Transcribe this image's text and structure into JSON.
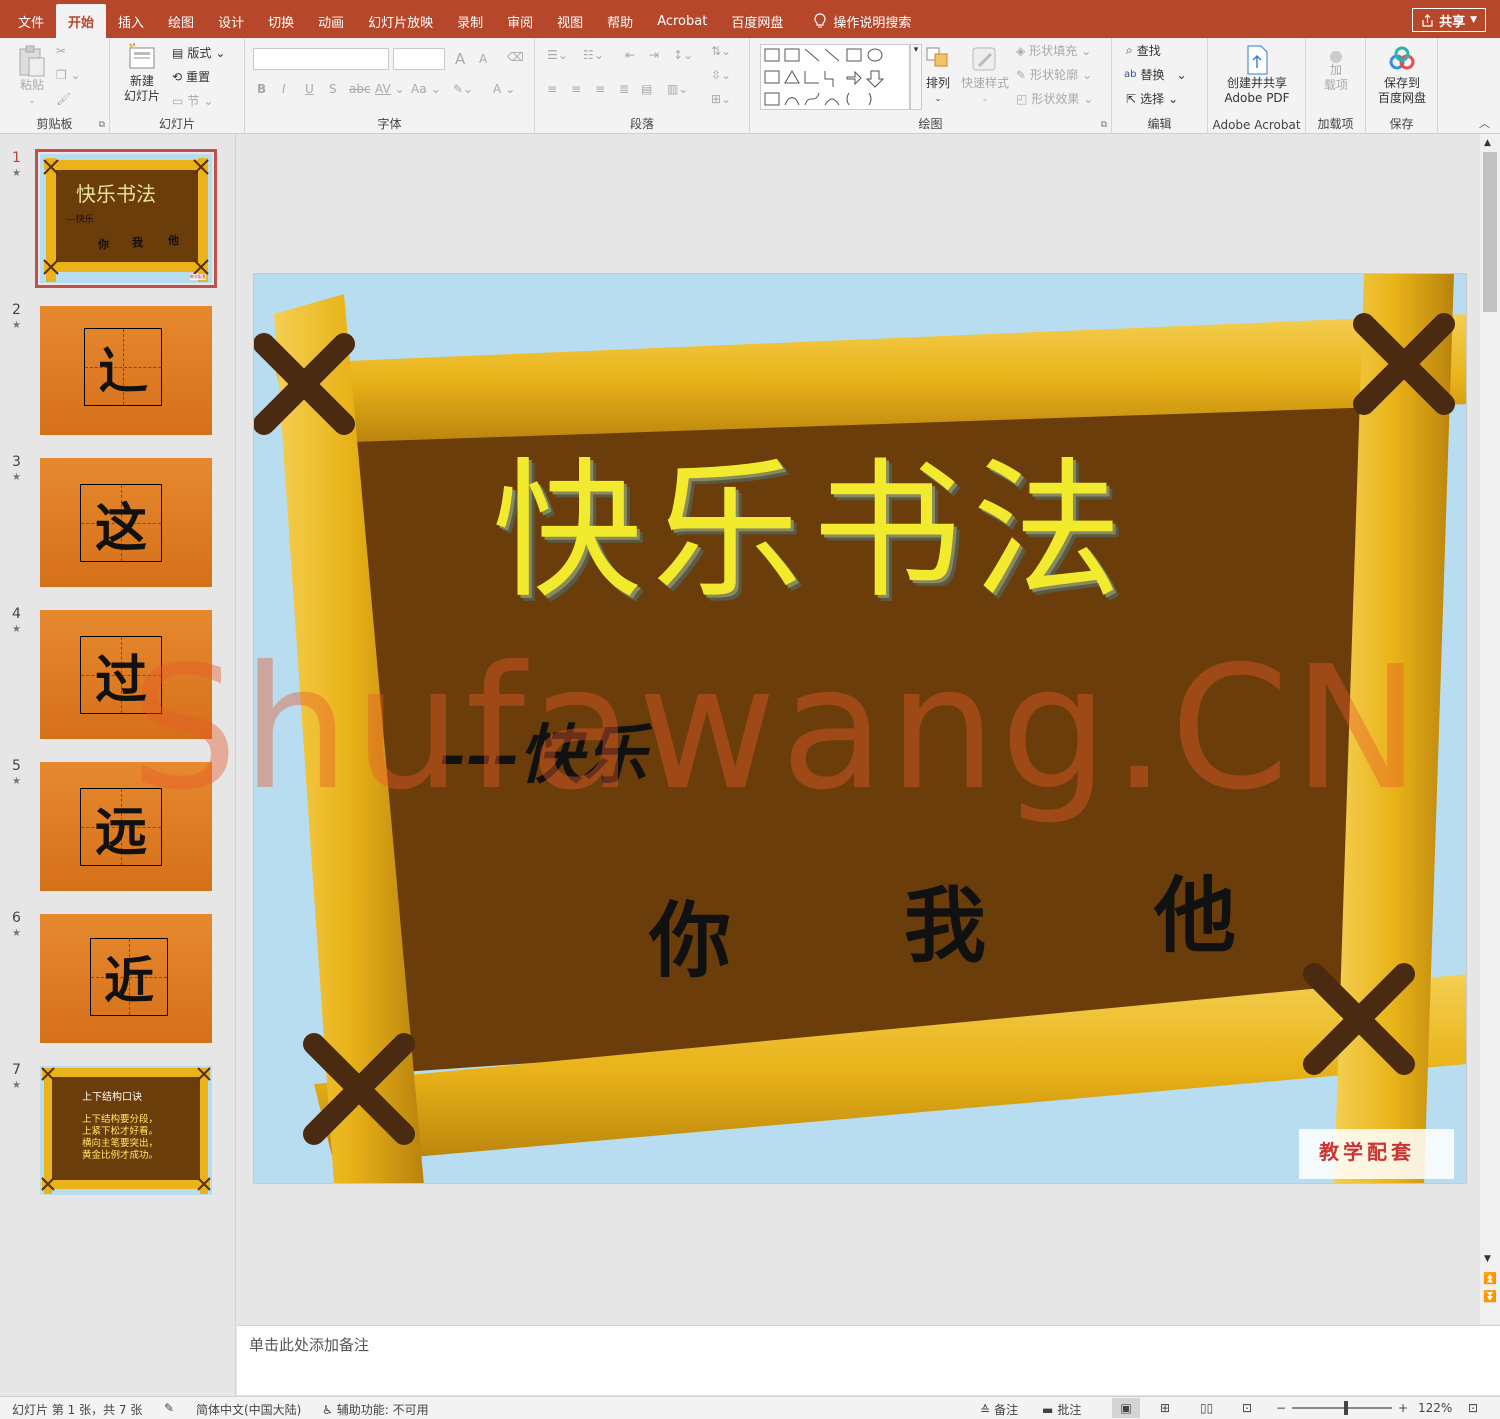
{
  "tabs": [
    "文件",
    "开始",
    "插入",
    "绘图",
    "设计",
    "切换",
    "动画",
    "幻灯片放映",
    "录制",
    "审阅",
    "视图",
    "帮助",
    "Acrobat",
    "百度网盘"
  ],
  "search_tab": "操作说明搜索",
  "share_label": "共享",
  "ribbon": {
    "clipboard": {
      "label": "剪贴板",
      "paste": "粘贴"
    },
    "slides": {
      "label": "幻灯片",
      "new_slide": "新建\n幻灯片",
      "layout": "版式",
      "reset": "重置",
      "section": "节"
    },
    "font": {
      "label": "字体",
      "bold": "B",
      "italic": "I",
      "underline": "U",
      "shadow": "S",
      "strike": "abc",
      "spacing": "AV",
      "case": "Aa",
      "color": "A",
      "grow": "A",
      "shrink": "A"
    },
    "paragraph": {
      "label": "段落"
    },
    "drawing": {
      "label": "绘图",
      "arrange": "排列",
      "quick_styles": "快速样式",
      "fill": "形状填充",
      "outline": "形状轮廓",
      "effects": "形状效果"
    },
    "editing": {
      "label": "编辑",
      "find": "查找",
      "replace": "替换",
      "select": "选择"
    },
    "acrobat": {
      "label": "Adobe Acrobat",
      "create": "创建并共享\nAdobe PDF"
    },
    "addins": {
      "label": "加载项",
      "addin": "加\n载项"
    },
    "save": {
      "label": "保存",
      "save_to": "保存到\n百度网盘"
    }
  },
  "thumbnails": [
    {
      "num": "1",
      "kind": "title",
      "title": "快乐书法",
      "sub": "---快乐",
      "names": [
        "你",
        "我",
        "他"
      ],
      "badge": "教学配套"
    },
    {
      "num": "2",
      "kind": "char",
      "char": "辶"
    },
    {
      "num": "3",
      "kind": "char",
      "char": "这"
    },
    {
      "num": "4",
      "kind": "char",
      "char": "过"
    },
    {
      "num": "5",
      "kind": "char",
      "char": "远"
    },
    {
      "num": "6",
      "kind": "char",
      "char": "近"
    },
    {
      "num": "7",
      "kind": "text",
      "heading": "上下结构口诀",
      "lines": [
        "上下结构要分段，",
        "上紧下松才好看。",
        "横向主笔要突出，",
        "黄金比例才成功。"
      ]
    }
  ],
  "slide": {
    "title": "快乐书法",
    "subtitle": "---快乐",
    "names": [
      "你",
      "我",
      "他"
    ],
    "badge": "教学配套"
  },
  "watermark": "Shufawang.CN",
  "notes_placeholder": "单击此处添加备注",
  "status": {
    "slide_info": "幻灯片 第 1 张，共 7 张",
    "language": "简体中文(中国大陆)",
    "accessibility": "辅助功能: 不可用",
    "notes": "备注",
    "comments": "批注",
    "zoom": "122%"
  },
  "colors": {
    "accent": "#b7472a",
    "board": "#6a3d0a",
    "bamboo": "#e9b319",
    "sky": "#b8ddf0",
    "title_fill": "#f2ea2c",
    "thumb_orange": "#e07c25"
  }
}
